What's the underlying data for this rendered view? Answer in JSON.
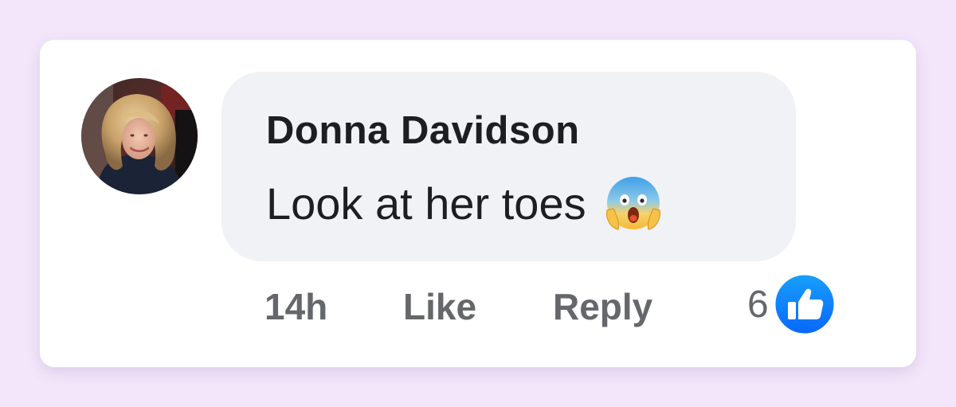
{
  "comment": {
    "author": "Donna Davidson",
    "text": "Look at her toes",
    "emoji": "face-screaming-in-fear-icon",
    "timestamp": "14h",
    "like_label": "Like",
    "reply_label": "Reply",
    "reaction_count": "6",
    "reaction_type": "like-reaction-icon"
  },
  "colors": {
    "page_background": "#f3e6fb",
    "card_background": "#ffffff",
    "bubble_background": "#f0f2f5",
    "text_primary": "#1c1e21",
    "text_secondary": "#65676b",
    "like_blue": "#1877f2"
  }
}
